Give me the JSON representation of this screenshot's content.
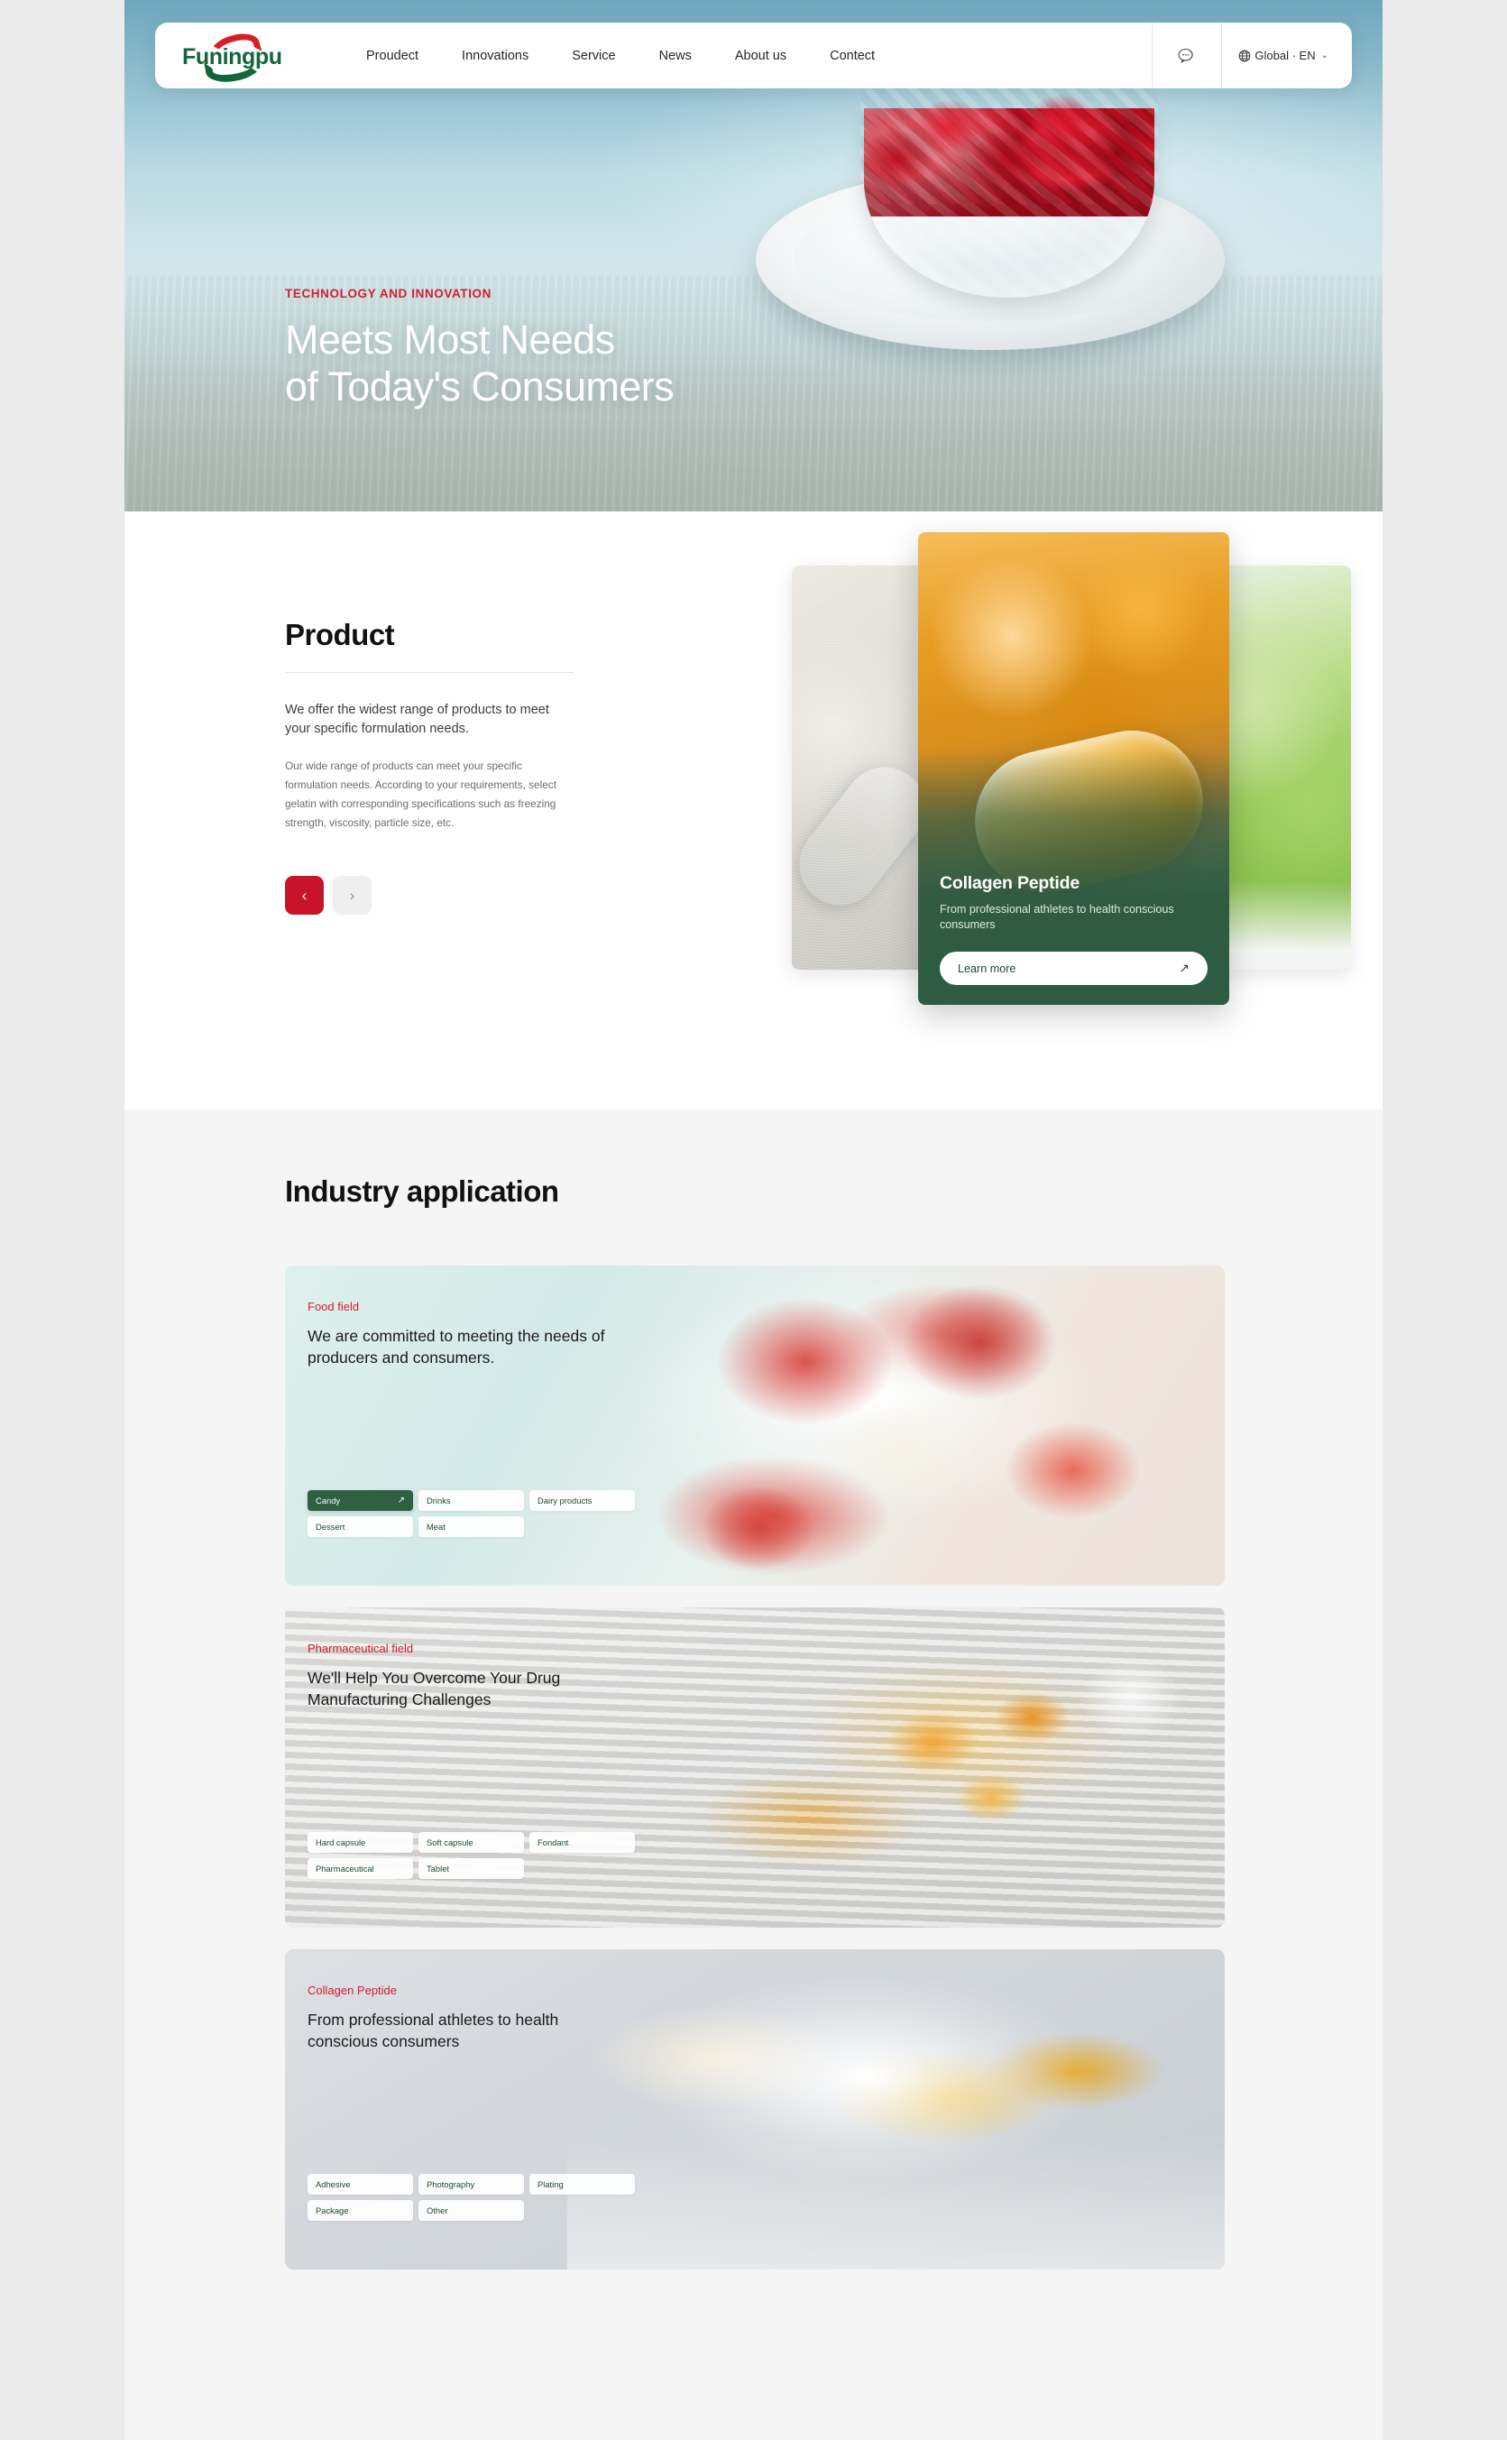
{
  "brand": {
    "name": "Funingpu",
    "logo_red": "#d81f26",
    "logo_green": "#14663a"
  },
  "nav": {
    "links": [
      {
        "label": "Proudect"
      },
      {
        "label": "Innovations"
      },
      {
        "label": "Service"
      },
      {
        "label": "News"
      },
      {
        "label": "About us"
      },
      {
        "label": "Contect"
      }
    ],
    "chat_icon": "chat-bubble-icon",
    "language": {
      "icon": "globe-icon",
      "label": "Global · EN",
      "chevron": "⌄"
    }
  },
  "hero": {
    "eyebrow": "TECHNOLOGY AND INNOVATION",
    "title_line1": "Meets Most Needs",
    "title_line2": "of Today's Consumers",
    "accent_color": "#cc2233"
  },
  "product": {
    "title": "Product",
    "lead": "We offer the widest range of products to meet your specific formulation needs.",
    "body": "Our wide range of products can meet your specific formulation needs. According to your requirements, select gelatin with corresponding specifications such as freezing strength, viscosity, particle size, etc.",
    "prev_icon": "‹",
    "next_icon": "›",
    "prev_color": "#c8142a",
    "next_color": "#efefef",
    "slide": {
      "title": "Collagen Peptide",
      "subtitle": "From professional athletes to health conscious consumers",
      "button_label": "Learn more",
      "button_arrow": "↗"
    }
  },
  "industry": {
    "title": "Industry application",
    "cards": [
      {
        "kicker": "Food field",
        "kicker_color": "#d01e33",
        "heading": "We are committed to meeting the needs of producers and consumers.",
        "chips_row1": [
          "Candy",
          "Drinks",
          "Dairy products"
        ],
        "chips_row2": [
          "Dessert",
          "Meat"
        ],
        "active_chip": "Candy",
        "chip_arrow": "↗"
      },
      {
        "kicker": "Pharmaceutical field",
        "kicker_color": "#d01e33",
        "heading": "We'll Help You Overcome Your Drug Manufacturing Challenges",
        "chips_row1": [
          "Hard capsule",
          "Soft capsule",
          "Fondant"
        ],
        "chips_row2": [
          "Pharmaceutical",
          "Tablet"
        ],
        "active_chip": "",
        "chip_arrow": "↗"
      },
      {
        "kicker": "Collagen Peptide",
        "kicker_color": "#d01e33",
        "heading": "From professional athletes to health conscious consumers",
        "chips_row1": [
          "Adhesive",
          "Photography",
          "Plating"
        ],
        "chips_row2": [
          "Package",
          "Other"
        ],
        "active_chip": "",
        "chip_arrow": "↗"
      }
    ]
  }
}
